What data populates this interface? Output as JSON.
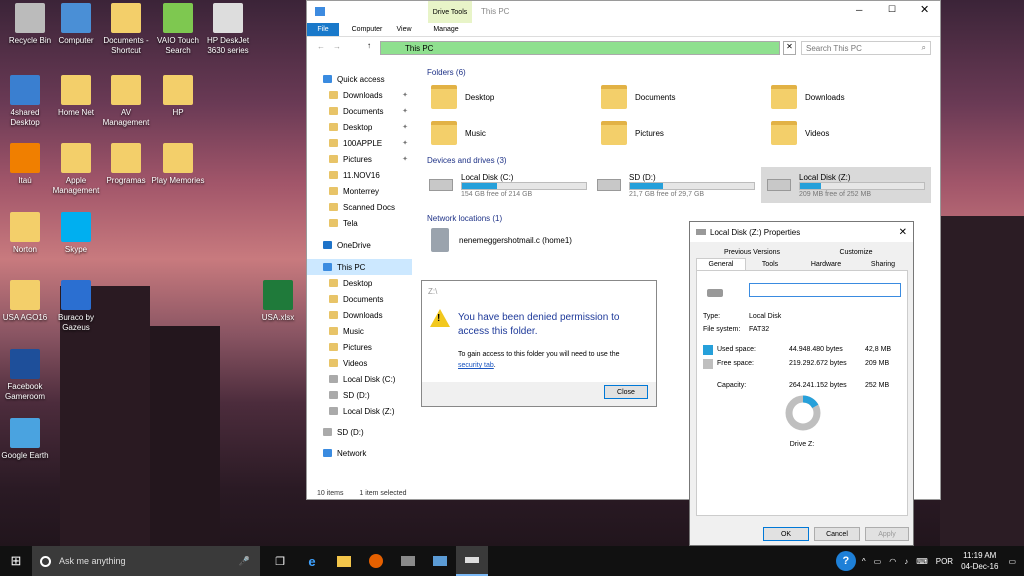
{
  "desktop": {
    "icons": [
      {
        "label": "Recycle Bin",
        "icon": "recycle-bin-icon"
      },
      {
        "label": "Computer",
        "icon": "computer-icon"
      },
      {
        "label": "Documents - Shortcut",
        "icon": "documents-shortcut-icon"
      },
      {
        "label": "VAIO Touch Search",
        "icon": "vaio-search-icon"
      },
      {
        "label": "HP DeskJet 3630 series",
        "icon": "printer-icon"
      },
      {
        "label": "4shared Desktop",
        "icon": "4shared-icon"
      },
      {
        "label": "Home Net",
        "icon": "home-net-icon"
      },
      {
        "label": "AV Management",
        "icon": "av-management-icon"
      },
      {
        "label": "HP",
        "icon": "hp-icon"
      },
      {
        "label": "Itaú",
        "icon": "itau-icon"
      },
      {
        "label": "Apple Management",
        "icon": "apple-management-icon"
      },
      {
        "label": "Programas",
        "icon": "programas-icon"
      },
      {
        "label": "Play Memories",
        "icon": "play-memories-icon"
      },
      {
        "label": "Norton",
        "icon": "norton-icon"
      },
      {
        "label": "Skype",
        "icon": "skype-icon"
      },
      {
        "label": "USA AGO16",
        "icon": "usa-ago16-icon"
      },
      {
        "label": "Buraco by Gazeus",
        "icon": "buraco-icon"
      },
      {
        "label": "USA.xlsx",
        "icon": "excel-file-icon"
      },
      {
        "label": "Facebook Gameroom",
        "icon": "facebook-gameroom-icon"
      },
      {
        "label": "Google Earth",
        "icon": "google-earth-icon"
      }
    ]
  },
  "explorer": {
    "ribbon": {
      "tools_label": "Drive Tools",
      "title": "This PC",
      "tabs": [
        "File",
        "Computer",
        "View",
        "Manage"
      ]
    },
    "address": {
      "path": "This PC",
      "search_placeholder": "Search This PC"
    },
    "nav": {
      "quick_access": "Quick access",
      "items": [
        "Downloads",
        "Documents",
        "Desktop",
        "100APPLE",
        "Pictures",
        "11.NOV16",
        "Monterrey",
        "Scanned Docs",
        "Tela"
      ],
      "onedrive": "OneDrive",
      "this_pc": "This PC",
      "pc_items": [
        "Desktop",
        "Documents",
        "Downloads",
        "Music",
        "Pictures",
        "Videos",
        "Local Disk (C:)",
        "SD (D:)",
        "Local Disk (Z:)"
      ],
      "sd": "SD (D:)",
      "network": "Network"
    },
    "folders": {
      "header": "Folders (6)",
      "items": [
        "Desktop",
        "Documents",
        "Downloads",
        "Music",
        "Pictures",
        "Videos"
      ]
    },
    "devices": {
      "header": "Devices and drives (3)",
      "items": [
        {
          "name": "Local Disk (C:)",
          "free": "154 GB free of 214 GB",
          "used_fraction": 0.28
        },
        {
          "name": "SD (D:)",
          "free": "21,7 GB free of 29,7 GB",
          "used_fraction": 0.27
        },
        {
          "name": "Local Disk (Z:)",
          "free": "209 MB free of 252 MB",
          "used_fraction": 0.17
        }
      ]
    },
    "network": {
      "header": "Network locations (1)",
      "item": "nenemeggershotmail.c (home1)"
    },
    "status": {
      "count": "10 items",
      "selected": "1 item selected"
    }
  },
  "dialog": {
    "path": "Z:\\",
    "message": "You have been denied permission to access this folder.",
    "hint": "To gain access to this folder you will need to use the",
    "link": "security tab",
    "close": "Close"
  },
  "properties": {
    "title": "Local Disk (Z:) Properties",
    "tabs_top": [
      "Previous Versions",
      "Customize"
    ],
    "tabs_bottom": [
      "General",
      "Tools",
      "Hardware",
      "Sharing"
    ],
    "type_label": "Type:",
    "type": "Local Disk",
    "fs_label": "File system:",
    "fs": "FAT32",
    "used_label": "Used space:",
    "used_bytes": "44.948.480 bytes",
    "used_size": "42,8 MB",
    "free_label": "Free space:",
    "free_bytes": "219.292.672 bytes",
    "free_size": "209 MB",
    "cap_label": "Capacity:",
    "cap_bytes": "264.241.152 bytes",
    "cap_size": "252 MB",
    "drive": "Drive Z:",
    "ok": "OK",
    "cancel": "Cancel",
    "apply": "Apply",
    "used_color": "#26a0da",
    "free_color": "#bfbfbf"
  },
  "taskbar": {
    "search": "Ask me anything",
    "lang": "POR",
    "time": "11:19 AM",
    "date": "04-Dec-16"
  }
}
